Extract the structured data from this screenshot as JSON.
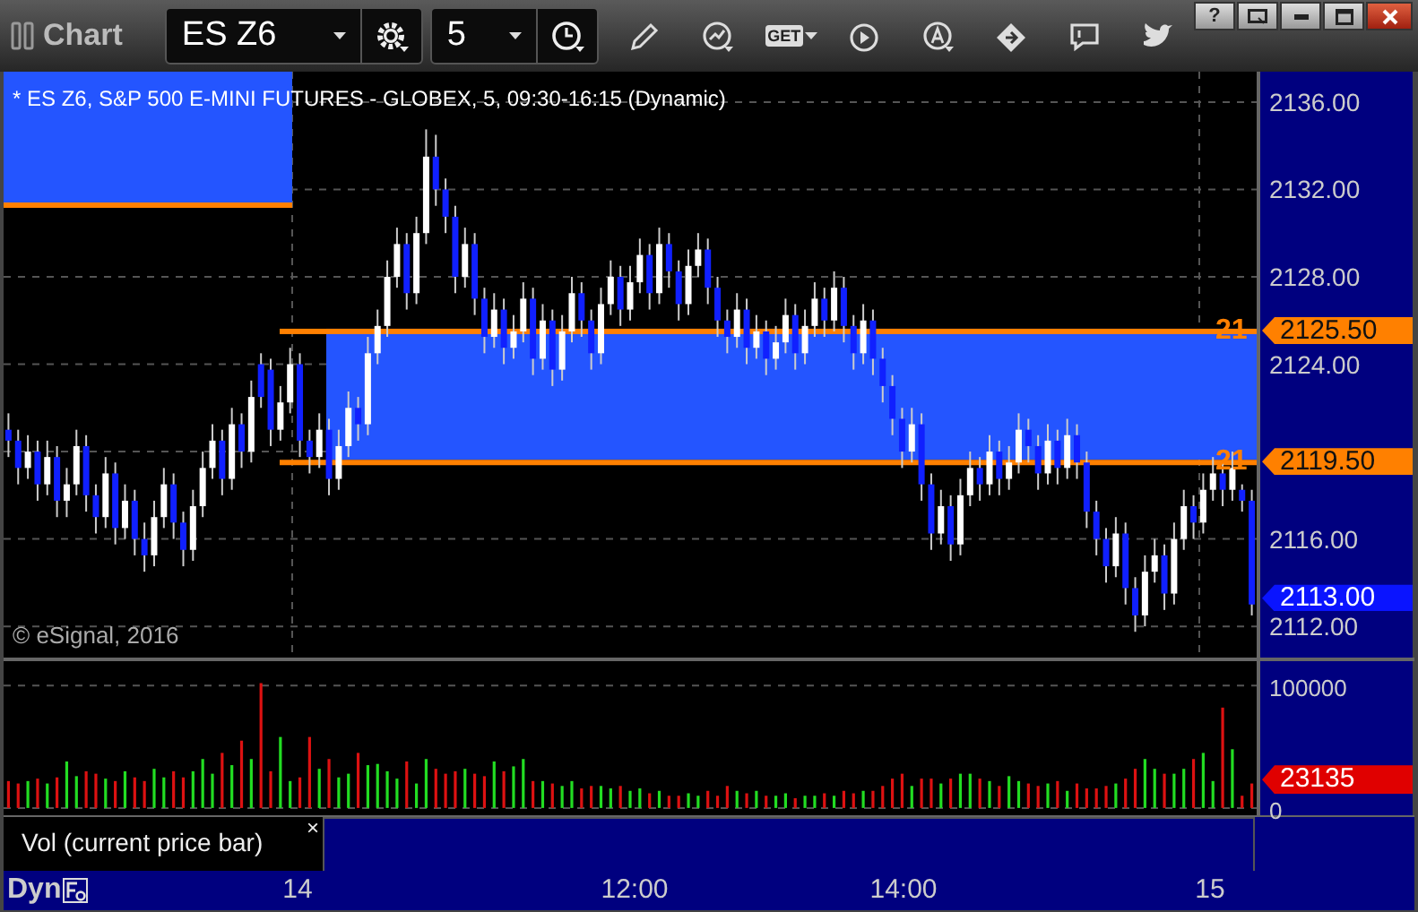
{
  "window": {
    "title": "Chart",
    "help": "?"
  },
  "toolbar": {
    "symbol": "ES Z6",
    "interval": "5",
    "get_label": "GET"
  },
  "chart": {
    "header": "* ES Z6, S&P 500 E-MINI FUTURES - GLOBEX, 5, 09:30-16:15 (Dynamic)",
    "copyright": "© eSignal, 2016",
    "markers": [
      {
        "kind": "level",
        "text": "2125.50",
        "stub": "21",
        "color": "#ff8000"
      },
      {
        "kind": "level",
        "text": "2119.50",
        "stub": "21",
        "color": "#ff8000"
      },
      {
        "kind": "last",
        "text": "2113.00",
        "color": "#0a14ff"
      }
    ],
    "chart_data": {
      "type": "candlestick",
      "grid": true,
      "ylim": [
        2110.57,
        2137.39
      ],
      "yticks": [
        {
          "value": 2136,
          "label": "2136.00"
        },
        {
          "value": 2132,
          "label": "2132.00"
        },
        {
          "value": 2128,
          "label": "2128.00"
        },
        {
          "value": 2124,
          "label": "2124.00"
        },
        {
          "value": 2116,
          "label": "2116.00"
        },
        {
          "value": 2112,
          "label": "2112.00"
        }
      ],
      "categories": [
        null,
        null,
        null,
        null,
        null,
        null,
        null,
        null,
        null,
        null,
        null,
        null,
        null,
        null,
        null,
        null,
        null,
        null,
        null,
        null,
        null,
        null,
        null,
        null,
        null,
        null,
        null,
        null,
        null,
        null,
        null,
        null,
        null,
        null,
        null,
        null,
        null,
        null,
        null,
        null,
        null,
        null,
        null,
        null,
        null,
        null,
        null,
        null,
        null,
        null,
        null,
        null,
        null,
        null,
        null,
        null,
        null,
        null,
        null,
        null,
        null,
        null,
        null,
        null,
        null,
        null,
        null,
        null,
        null,
        null,
        null,
        null,
        null,
        null,
        null,
        null,
        null,
        null,
        null,
        null,
        null,
        null,
        null,
        null,
        null,
        null,
        null,
        null,
        null,
        null,
        null,
        null,
        null,
        null,
        null,
        null,
        null,
        null,
        null,
        null,
        null,
        null,
        null,
        null,
        null,
        null,
        null,
        null,
        null,
        null,
        null,
        null,
        null,
        null,
        null,
        null,
        null,
        null,
        null,
        null,
        null,
        null,
        null,
        null,
        null,
        null,
        null,
        null,
        null
      ],
      "ohlc": [
        [
          2121,
          2121.75,
          2119.75,
          2120.5
        ],
        [
          2120.5,
          2121,
          2118.5,
          2119.25
        ],
        [
          2119.25,
          2120.75,
          2118.75,
          2120
        ],
        [
          2120,
          2120.5,
          2117.75,
          2118.5
        ],
        [
          2118.5,
          2120.5,
          2118,
          2119.75
        ],
        [
          2119.75,
          2120.25,
          2117,
          2117.75
        ],
        [
          2117.75,
          2119.25,
          2117,
          2118.5
        ],
        [
          2118.5,
          2121,
          2118,
          2120.25
        ],
        [
          2120.25,
          2120.75,
          2117.25,
          2118
        ],
        [
          2118,
          2118.5,
          2116.25,
          2117
        ],
        [
          2117,
          2119.75,
          2116.5,
          2119
        ],
        [
          2119,
          2119.5,
          2115.75,
          2116.5
        ],
        [
          2116.5,
          2118.5,
          2116,
          2117.75
        ],
        [
          2117.75,
          2118.25,
          2115.25,
          2116
        ],
        [
          2116,
          2116.75,
          2114.5,
          2115.25
        ],
        [
          2115.25,
          2117.75,
          2114.75,
          2117
        ],
        [
          2117,
          2119.25,
          2116.5,
          2118.5
        ],
        [
          2118.5,
          2119,
          2116,
          2116.75
        ],
        [
          2116.75,
          2117.25,
          2114.75,
          2115.5
        ],
        [
          2115.5,
          2118.25,
          2115,
          2117.5
        ],
        [
          2117.5,
          2120,
          2117,
          2119.25
        ],
        [
          2119.25,
          2121.25,
          2118.75,
          2120.5
        ],
        [
          2120.5,
          2121,
          2118,
          2118.75
        ],
        [
          2118.75,
          2122,
          2118.25,
          2121.25
        ],
        [
          2121.25,
          2121.75,
          2119.25,
          2120
        ],
        [
          2120,
          2123.25,
          2119.5,
          2122.5
        ],
        [
          2124,
          2124.5,
          2122,
          2122.5
        ],
        [
          2123.75,
          2124.25,
          2120.25,
          2121
        ],
        [
          2121,
          2123,
          2120.5,
          2122.25
        ],
        [
          2122.25,
          2124.75,
          2121.75,
          2124
        ],
        [
          2124,
          2124.5,
          2119.75,
          2120.5
        ],
        [
          2120.5,
          2121,
          2119,
          2119.75
        ],
        [
          2119.75,
          2121.75,
          2119.25,
          2121
        ],
        [
          2121,
          2121.5,
          2118,
          2118.75
        ],
        [
          2118.75,
          2121,
          2118.25,
          2120.25
        ],
        [
          2120.25,
          2122.75,
          2119.75,
          2122
        ],
        [
          2122,
          2122.5,
          2120.5,
          2121.25
        ],
        [
          2121.25,
          2125.25,
          2120.75,
          2124.5
        ],
        [
          2124.5,
          2126.5,
          2124,
          2125.75
        ],
        [
          2125.75,
          2128.75,
          2125.25,
          2128
        ],
        [
          2128,
          2130.25,
          2127.5,
          2129.5
        ],
        [
          2129.5,
          2130,
          2126.5,
          2127.25
        ],
        [
          2127.25,
          2130.75,
          2126.75,
          2130
        ],
        [
          2130,
          2134.75,
          2129.5,
          2133.5
        ],
        [
          2133.5,
          2134.5,
          2131.25,
          2132
        ],
        [
          2132,
          2132.5,
          2130,
          2130.75
        ],
        [
          2130.75,
          2131.25,
          2127.25,
          2128
        ],
        [
          2128,
          2130.25,
          2127.5,
          2129.5
        ],
        [
          2129.5,
          2130,
          2126.25,
          2127
        ],
        [
          2127,
          2127.5,
          2124.5,
          2125.25
        ],
        [
          2125.25,
          2127.25,
          2124.75,
          2126.5
        ],
        [
          2126.5,
          2127,
          2124,
          2124.75
        ],
        [
          2124.75,
          2126.25,
          2124.25,
          2125.5
        ],
        [
          2125.5,
          2127.75,
          2125,
          2127
        ],
        [
          2127,
          2127.5,
          2123.5,
          2124.25
        ],
        [
          2124.25,
          2126.75,
          2123.75,
          2126
        ],
        [
          2126,
          2126.5,
          2123,
          2123.75
        ],
        [
          2123.75,
          2126.25,
          2123.25,
          2125.5
        ],
        [
          2125.5,
          2128,
          2125,
          2127.25
        ],
        [
          2127.25,
          2127.75,
          2125.25,
          2126
        ],
        [
          2126,
          2126.5,
          2123.75,
          2124.5
        ],
        [
          2124.5,
          2127.5,
          2124,
          2126.75
        ],
        [
          2126.75,
          2128.75,
          2126.25,
          2128
        ],
        [
          2128,
          2128.5,
          2125.75,
          2126.5
        ],
        [
          2126.5,
          2128.5,
          2126,
          2127.75
        ],
        [
          2127.75,
          2129.75,
          2127.25,
          2129
        ],
        [
          2129,
          2129.5,
          2126.5,
          2127.25
        ],
        [
          2127.25,
          2130.25,
          2126.75,
          2129.5
        ],
        [
          2129.5,
          2130,
          2127.5,
          2128.25
        ],
        [
          2128.25,
          2128.75,
          2126,
          2126.75
        ],
        [
          2126.75,
          2129.25,
          2126.25,
          2128.5
        ],
        [
          2128.5,
          2130,
          2128,
          2129.25
        ],
        [
          2129.25,
          2129.75,
          2126.75,
          2127.5
        ],
        [
          2127.5,
          2128,
          2125.25,
          2126
        ],
        [
          2126,
          2126.5,
          2124.5,
          2125.25
        ],
        [
          2125.25,
          2127.25,
          2124.75,
          2126.5
        ],
        [
          2126.5,
          2127,
          2124,
          2124.75
        ],
        [
          2124.75,
          2126.25,
          2124.25,
          2125.5
        ],
        [
          2125.5,
          2126,
          2123.5,
          2124.25
        ],
        [
          2124.25,
          2125.75,
          2123.75,
          2125
        ],
        [
          2125,
          2127,
          2124.5,
          2126.25
        ],
        [
          2126.25,
          2126.75,
          2123.75,
          2124.5
        ],
        [
          2124.5,
          2126.5,
          2124,
          2125.75
        ],
        [
          2125.75,
          2127.75,
          2125.25,
          2127
        ],
        [
          2127,
          2127.5,
          2125.25,
          2126
        ],
        [
          2126,
          2128.25,
          2125.5,
          2127.5
        ],
        [
          2127.5,
          2128,
          2125,
          2125.75
        ],
        [
          2125.75,
          2126.25,
          2123.75,
          2124.5
        ],
        [
          2124.5,
          2126.75,
          2124,
          2126
        ],
        [
          2126,
          2126.5,
          2123.5,
          2124.25
        ],
        [
          2124.25,
          2124.75,
          2122.25,
          2123
        ],
        [
          2123,
          2123.5,
          2120.75,
          2121.5
        ],
        [
          2121.5,
          2122,
          2119.25,
          2120
        ],
        [
          2120,
          2122,
          2119.5,
          2121.25
        ],
        [
          2121.25,
          2121.75,
          2117.75,
          2118.5
        ],
        [
          2118.5,
          2119,
          2115.5,
          2116.25
        ],
        [
          2116.25,
          2118.25,
          2115.75,
          2117.5
        ],
        [
          2117.5,
          2118,
          2115,
          2115.75
        ],
        [
          2115.75,
          2118.75,
          2115.25,
          2118
        ],
        [
          2118,
          2120,
          2117.5,
          2119.25
        ],
        [
          2119.25,
          2119.75,
          2117.75,
          2118.5
        ],
        [
          2118.5,
          2120.75,
          2118,
          2120
        ],
        [
          2120,
          2120.5,
          2118,
          2118.75
        ],
        [
          2118.75,
          2120.25,
          2118.25,
          2119.5
        ],
        [
          2119.5,
          2121.75,
          2119,
          2121
        ],
        [
          2121,
          2121.5,
          2119.5,
          2120.25
        ],
        [
          2120.25,
          2120.75,
          2118.25,
          2119
        ],
        [
          2119,
          2121.25,
          2118.5,
          2120.5
        ],
        [
          2120.5,
          2121,
          2118.5,
          2119.25
        ],
        [
          2119.25,
          2121.5,
          2118.75,
          2120.75
        ],
        [
          2120.75,
          2121.25,
          2118.75,
          2119.5
        ],
        [
          2119.5,
          2120,
          2116.5,
          2117.25
        ],
        [
          2117.25,
          2117.75,
          2115.25,
          2116
        ],
        [
          2116,
          2116.5,
          2114,
          2114.75
        ],
        [
          2114.75,
          2117,
          2114.25,
          2116.25
        ],
        [
          2116.25,
          2116.75,
          2113,
          2113.75
        ],
        [
          2113.75,
          2114.25,
          2111.75,
          2112.5
        ],
        [
          2112.5,
          2115.25,
          2112,
          2114.5
        ],
        [
          2114.5,
          2116,
          2114,
          2115.25
        ],
        [
          2115.25,
          2115.75,
          2112.75,
          2113.5
        ],
        [
          2113.5,
          2116.75,
          2113,
          2116
        ],
        [
          2116,
          2118.25,
          2115.5,
          2117.5
        ],
        [
          2117.5,
          2118,
          2116,
          2116.75
        ],
        [
          2116.75,
          2119,
          2116.25,
          2118.25
        ],
        [
          2118.25,
          2119.75,
          2117.75,
          2119
        ],
        [
          2119,
          2119.5,
          2117.5,
          2118.25
        ],
        [
          2118.25,
          2120,
          2117.75,
          2119.25
        ],
        [
          2118.25,
          2118.5,
          2117.25,
          2117.75
        ],
        [
          2117.75,
          2118.25,
          2112.5,
          2113
        ]
      ]
    }
  },
  "volume": {
    "marker": {
      "text": "23135",
      "color": "#e00000"
    },
    "study": "Vol (current price bar)",
    "close": "×",
    "chart_data": {
      "type": "bar",
      "grid": true,
      "ylim": [
        -3000,
        117000
      ],
      "yticks": [
        {
          "value": 100000,
          "label": "100000"
        },
        {
          "value": 0,
          "label": "0"
        }
      ],
      "categories": [
        null,
        null,
        null,
        null,
        null,
        null,
        null,
        null,
        null,
        null,
        null,
        null,
        null,
        null,
        null,
        null,
        null,
        null,
        null,
        null,
        null,
        null,
        null,
        null,
        null,
        null,
        null,
        null,
        null,
        null,
        null,
        null,
        null,
        null,
        null,
        null,
        null,
        null,
        null,
        null,
        null,
        null,
        null,
        null,
        null,
        null,
        null,
        null,
        null,
        null,
        null,
        null,
        null,
        null,
        null,
        null,
        null,
        null,
        null,
        null,
        null,
        null,
        null,
        null,
        null,
        null,
        null,
        null,
        null,
        null,
        null,
        null,
        null,
        null,
        null,
        null,
        null,
        null,
        null,
        null,
        null,
        null,
        null,
        null,
        null,
        null,
        null,
        null,
        null,
        null,
        null,
        null,
        null,
        null,
        null,
        null,
        null,
        null,
        null,
        null,
        null,
        null,
        null,
        null,
        null,
        null,
        null,
        null,
        null,
        null,
        null,
        null,
        null,
        null,
        null,
        null,
        null,
        null,
        null,
        null,
        null,
        null,
        null,
        null,
        null,
        null,
        null,
        null,
        null
      ],
      "series": [
        {
          "color": "#22dd22",
          "values": [
            null,
            null,
            22000,
            null,
            20000,
            null,
            38000,
            26000,
            null,
            null,
            24000,
            null,
            30000,
            null,
            null,
            32000,
            25000,
            null,
            null,
            30000,
            40000,
            28000,
            null,
            35000,
            null,
            40000,
            null,
            null,
            58000,
            22000,
            null,
            null,
            32000,
            null,
            25000,
            28000,
            null,
            35000,
            36000,
            30000,
            24000,
            null,
            20000,
            40000,
            null,
            null,
            null,
            32000,
            null,
            null,
            38000,
            null,
            34000,
            40000,
            null,
            22000,
            null,
            18000,
            22000,
            null,
            null,
            18000,
            16000,
            null,
            14000,
            16000,
            null,
            14000,
            null,
            null,
            12000,
            10000,
            null,
            null,
            null,
            14000,
            null,
            14000,
            null,
            10000,
            12000,
            null,
            10000,
            10000,
            null,
            10000,
            null,
            null,
            14000,
            null,
            null,
            null,
            null,
            18000,
            null,
            null,
            20000,
            null,
            28000,
            28000,
            null,
            22000,
            null,
            26000,
            22000,
            null,
            null,
            20000,
            null,
            14000,
            null,
            null,
            null,
            null,
            20000,
            null,
            null,
            40000,
            32000,
            null,
            28000,
            32000,
            null,
            45000,
            22000,
            null,
            48000,
            null,
            null
          ]
        },
        {
          "color": "#dd1111",
          "values": [
            22000,
            20000,
            null,
            24000,
            null,
            25000,
            null,
            null,
            30000,
            28000,
            null,
            22000,
            null,
            25000,
            22000,
            null,
            null,
            30000,
            25000,
            null,
            null,
            null,
            45000,
            null,
            55000,
            null,
            102000,
            30000,
            null,
            null,
            25000,
            58000,
            null,
            40000,
            null,
            null,
            45000,
            null,
            null,
            null,
            null,
            38000,
            null,
            null,
            32000,
            28000,
            30000,
            null,
            28000,
            26000,
            null,
            30000,
            null,
            null,
            22000,
            null,
            20000,
            null,
            null,
            16000,
            18000,
            null,
            null,
            18000,
            null,
            null,
            12000,
            null,
            10000,
            10000,
            null,
            null,
            14000,
            10000,
            18000,
            null,
            12000,
            null,
            10000,
            null,
            null,
            8000,
            null,
            null,
            12000,
            null,
            14000,
            12000,
            null,
            14000,
            18000,
            24000,
            28000,
            null,
            24000,
            24000,
            null,
            24000,
            null,
            null,
            24000,
            null,
            18000,
            null,
            null,
            20000,
            18000,
            null,
            22000,
            null,
            20000,
            16000,
            16000,
            18000,
            null,
            24000,
            32000,
            null,
            null,
            28000,
            null,
            null,
            40000,
            null,
            null,
            82000,
            null,
            10000,
            20000
          ]
        }
      ]
    }
  },
  "time_axis": {
    "mode": "Dyn",
    "labels": [
      "14",
      "12:00",
      "14:00",
      "15"
    ]
  }
}
